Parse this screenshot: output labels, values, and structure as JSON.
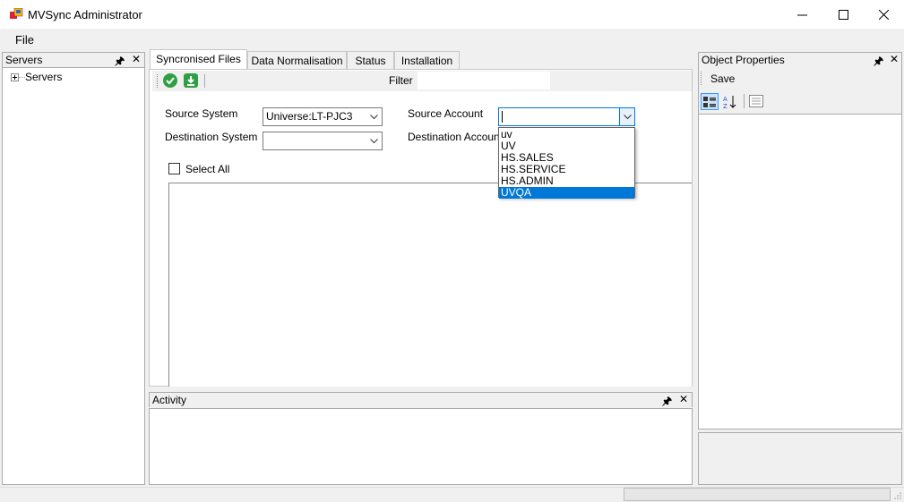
{
  "window": {
    "title": "MVSync Administrator"
  },
  "menu": {
    "file": "File"
  },
  "servers_panel": {
    "title": "Servers",
    "tree_root": "Servers"
  },
  "tabs": [
    {
      "label": "Syncronised Files",
      "active": true
    },
    {
      "label": "Data Normalisation"
    },
    {
      "label": "Status"
    },
    {
      "label": "Installation"
    }
  ],
  "toolbar": {
    "filter_label": "Filter",
    "filter_value": ""
  },
  "form": {
    "source_system_label": "Source System",
    "source_system_value": "Universe:LT-PJC3",
    "destination_system_label": "Destination System",
    "destination_system_value": "",
    "source_account_label": "Source Account",
    "source_account_value": "",
    "destination_account_label": "Destination Account",
    "select_all_label": "Select All"
  },
  "dropdown": {
    "options": [
      "uv",
      "UV",
      "HS.SALES",
      "HS.SERVICE",
      "HS.ADMIN",
      "UVQA"
    ],
    "highlighted": "UVQA"
  },
  "activity_panel": {
    "title": "Activity"
  },
  "properties_panel": {
    "title": "Object Properties",
    "save_label": "Save"
  },
  "colors": {
    "accent": "#0078d7",
    "ok_green": "#2ea043"
  }
}
